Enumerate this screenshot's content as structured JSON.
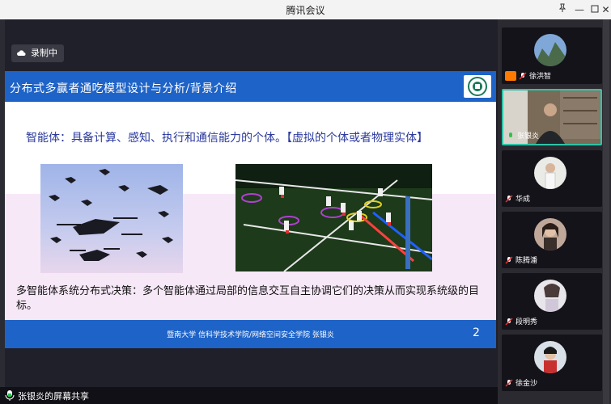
{
  "window": {
    "title": "腾讯会议"
  },
  "recording": {
    "label": "录制中"
  },
  "slide": {
    "title": "分布式多赢者通吃模型设计与分析/背景介绍",
    "statement1": "智能体：具备计算、感知、执行和通信能力的个体。【虚拟的个体或者物理实体】",
    "statement2": "多智能体系统分布式决策：多个智能体通过局部的信息交互自主协调它们的决策从而实现系统级的目标。",
    "footer": "暨南大学 信科学技术学院/网络空间安全学院 张银炎",
    "page_number": "2"
  },
  "share_bar": {
    "label": "张银炎的屏幕共享"
  },
  "participants": [
    {
      "name": "徐洪智",
      "mic": "muted",
      "active": false
    },
    {
      "name": "张银炎",
      "mic": "speaking",
      "active": true
    },
    {
      "name": "华成",
      "mic": "muted",
      "active": false
    },
    {
      "name": "陈腾潘",
      "mic": "muted",
      "active": false
    },
    {
      "name": "段明秀",
      "mic": "muted",
      "active": false
    },
    {
      "name": "徐金沙",
      "mic": "muted",
      "active": false
    }
  ],
  "colors": {
    "accent": "#2ec4a6",
    "slide_blue": "#1e63c7",
    "slide_pink": "#f7e8f8",
    "text_blue": "#2b3a9c"
  }
}
